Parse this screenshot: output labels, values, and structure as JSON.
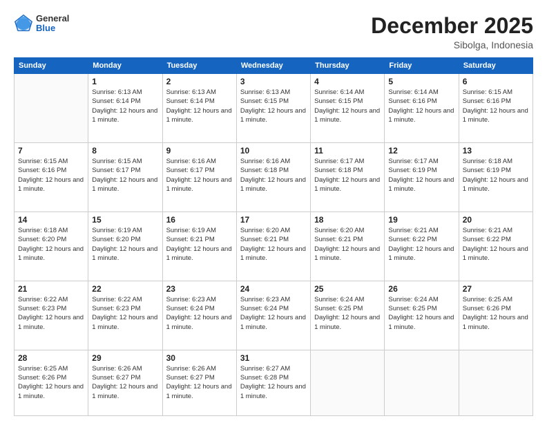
{
  "header": {
    "logo": {
      "general": "General",
      "blue": "Blue"
    },
    "month_title": "December 2025",
    "location": "Sibolga, Indonesia"
  },
  "days_of_week": [
    "Sunday",
    "Monday",
    "Tuesday",
    "Wednesday",
    "Thursday",
    "Friday",
    "Saturday"
  ],
  "weeks": [
    [
      {
        "day": "",
        "sunrise": "",
        "sunset": "",
        "daylight": ""
      },
      {
        "day": "1",
        "sunrise": "Sunrise: 6:13 AM",
        "sunset": "Sunset: 6:14 PM",
        "daylight": "Daylight: 12 hours and 1 minute."
      },
      {
        "day": "2",
        "sunrise": "Sunrise: 6:13 AM",
        "sunset": "Sunset: 6:14 PM",
        "daylight": "Daylight: 12 hours and 1 minute."
      },
      {
        "day": "3",
        "sunrise": "Sunrise: 6:13 AM",
        "sunset": "Sunset: 6:15 PM",
        "daylight": "Daylight: 12 hours and 1 minute."
      },
      {
        "day": "4",
        "sunrise": "Sunrise: 6:14 AM",
        "sunset": "Sunset: 6:15 PM",
        "daylight": "Daylight: 12 hours and 1 minute."
      },
      {
        "day": "5",
        "sunrise": "Sunrise: 6:14 AM",
        "sunset": "Sunset: 6:16 PM",
        "daylight": "Daylight: 12 hours and 1 minute."
      },
      {
        "day": "6",
        "sunrise": "Sunrise: 6:15 AM",
        "sunset": "Sunset: 6:16 PM",
        "daylight": "Daylight: 12 hours and 1 minute."
      }
    ],
    [
      {
        "day": "7",
        "sunrise": "Sunrise: 6:15 AM",
        "sunset": "Sunset: 6:16 PM",
        "daylight": "Daylight: 12 hours and 1 minute."
      },
      {
        "day": "8",
        "sunrise": "Sunrise: 6:15 AM",
        "sunset": "Sunset: 6:17 PM",
        "daylight": "Daylight: 12 hours and 1 minute."
      },
      {
        "day": "9",
        "sunrise": "Sunrise: 6:16 AM",
        "sunset": "Sunset: 6:17 PM",
        "daylight": "Daylight: 12 hours and 1 minute."
      },
      {
        "day": "10",
        "sunrise": "Sunrise: 6:16 AM",
        "sunset": "Sunset: 6:18 PM",
        "daylight": "Daylight: 12 hours and 1 minute."
      },
      {
        "day": "11",
        "sunrise": "Sunrise: 6:17 AM",
        "sunset": "Sunset: 6:18 PM",
        "daylight": "Daylight: 12 hours and 1 minute."
      },
      {
        "day": "12",
        "sunrise": "Sunrise: 6:17 AM",
        "sunset": "Sunset: 6:19 PM",
        "daylight": "Daylight: 12 hours and 1 minute."
      },
      {
        "day": "13",
        "sunrise": "Sunrise: 6:18 AM",
        "sunset": "Sunset: 6:19 PM",
        "daylight": "Daylight: 12 hours and 1 minute."
      }
    ],
    [
      {
        "day": "14",
        "sunrise": "Sunrise: 6:18 AM",
        "sunset": "Sunset: 6:20 PM",
        "daylight": "Daylight: 12 hours and 1 minute."
      },
      {
        "day": "15",
        "sunrise": "Sunrise: 6:19 AM",
        "sunset": "Sunset: 6:20 PM",
        "daylight": "Daylight: 12 hours and 1 minute."
      },
      {
        "day": "16",
        "sunrise": "Sunrise: 6:19 AM",
        "sunset": "Sunset: 6:21 PM",
        "daylight": "Daylight: 12 hours and 1 minute."
      },
      {
        "day": "17",
        "sunrise": "Sunrise: 6:20 AM",
        "sunset": "Sunset: 6:21 PM",
        "daylight": "Daylight: 12 hours and 1 minute."
      },
      {
        "day": "18",
        "sunrise": "Sunrise: 6:20 AM",
        "sunset": "Sunset: 6:21 PM",
        "daylight": "Daylight: 12 hours and 1 minute."
      },
      {
        "day": "19",
        "sunrise": "Sunrise: 6:21 AM",
        "sunset": "Sunset: 6:22 PM",
        "daylight": "Daylight: 12 hours and 1 minute."
      },
      {
        "day": "20",
        "sunrise": "Sunrise: 6:21 AM",
        "sunset": "Sunset: 6:22 PM",
        "daylight": "Daylight: 12 hours and 1 minute."
      }
    ],
    [
      {
        "day": "21",
        "sunrise": "Sunrise: 6:22 AM",
        "sunset": "Sunset: 6:23 PM",
        "daylight": "Daylight: 12 hours and 1 minute."
      },
      {
        "day": "22",
        "sunrise": "Sunrise: 6:22 AM",
        "sunset": "Sunset: 6:23 PM",
        "daylight": "Daylight: 12 hours and 1 minute."
      },
      {
        "day": "23",
        "sunrise": "Sunrise: 6:23 AM",
        "sunset": "Sunset: 6:24 PM",
        "daylight": "Daylight: 12 hours and 1 minute."
      },
      {
        "day": "24",
        "sunrise": "Sunrise: 6:23 AM",
        "sunset": "Sunset: 6:24 PM",
        "daylight": "Daylight: 12 hours and 1 minute."
      },
      {
        "day": "25",
        "sunrise": "Sunrise: 6:24 AM",
        "sunset": "Sunset: 6:25 PM",
        "daylight": "Daylight: 12 hours and 1 minute."
      },
      {
        "day": "26",
        "sunrise": "Sunrise: 6:24 AM",
        "sunset": "Sunset: 6:25 PM",
        "daylight": "Daylight: 12 hours and 1 minute."
      },
      {
        "day": "27",
        "sunrise": "Sunrise: 6:25 AM",
        "sunset": "Sunset: 6:26 PM",
        "daylight": "Daylight: 12 hours and 1 minute."
      }
    ],
    [
      {
        "day": "28",
        "sunrise": "Sunrise: 6:25 AM",
        "sunset": "Sunset: 6:26 PM",
        "daylight": "Daylight: 12 hours and 1 minute."
      },
      {
        "day": "29",
        "sunrise": "Sunrise: 6:26 AM",
        "sunset": "Sunset: 6:27 PM",
        "daylight": "Daylight: 12 hours and 1 minute."
      },
      {
        "day": "30",
        "sunrise": "Sunrise: 6:26 AM",
        "sunset": "Sunset: 6:27 PM",
        "daylight": "Daylight: 12 hours and 1 minute."
      },
      {
        "day": "31",
        "sunrise": "Sunrise: 6:27 AM",
        "sunset": "Sunset: 6:28 PM",
        "daylight": "Daylight: 12 hours and 1 minute."
      },
      {
        "day": "",
        "sunrise": "",
        "sunset": "",
        "daylight": ""
      },
      {
        "day": "",
        "sunrise": "",
        "sunset": "",
        "daylight": ""
      },
      {
        "day": "",
        "sunrise": "",
        "sunset": "",
        "daylight": ""
      }
    ]
  ]
}
